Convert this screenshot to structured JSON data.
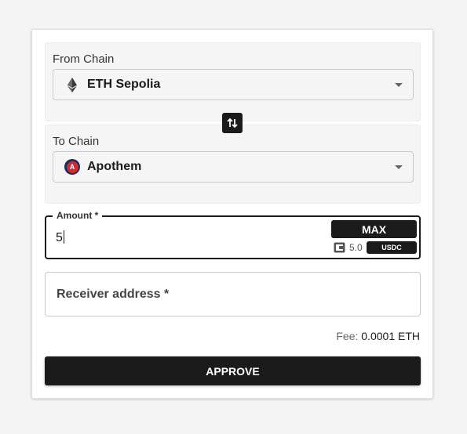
{
  "from_chain": {
    "label": "From Chain",
    "selected": "ETH Sepolia",
    "icon": "ethereum-icon"
  },
  "swap": {
    "icon": "swap-vertical-icon"
  },
  "to_chain": {
    "label": "To Chain",
    "selected": "Apothem",
    "icon": "apothem-icon",
    "icon_letter": "A"
  },
  "amount": {
    "label": "Amount *",
    "value": "5",
    "max_label": "MAX",
    "balance": "5.0",
    "token": "USDC"
  },
  "receiver": {
    "placeholder": "Receiver address *"
  },
  "fee": {
    "label": "Fee:",
    "value": "0.0001 ETH"
  },
  "approve_label": "APPROVE",
  "colors": {
    "primary": "#1b1b1b",
    "apothem_red": "#d22b2b",
    "apothem_navy": "#1e2b5e"
  }
}
